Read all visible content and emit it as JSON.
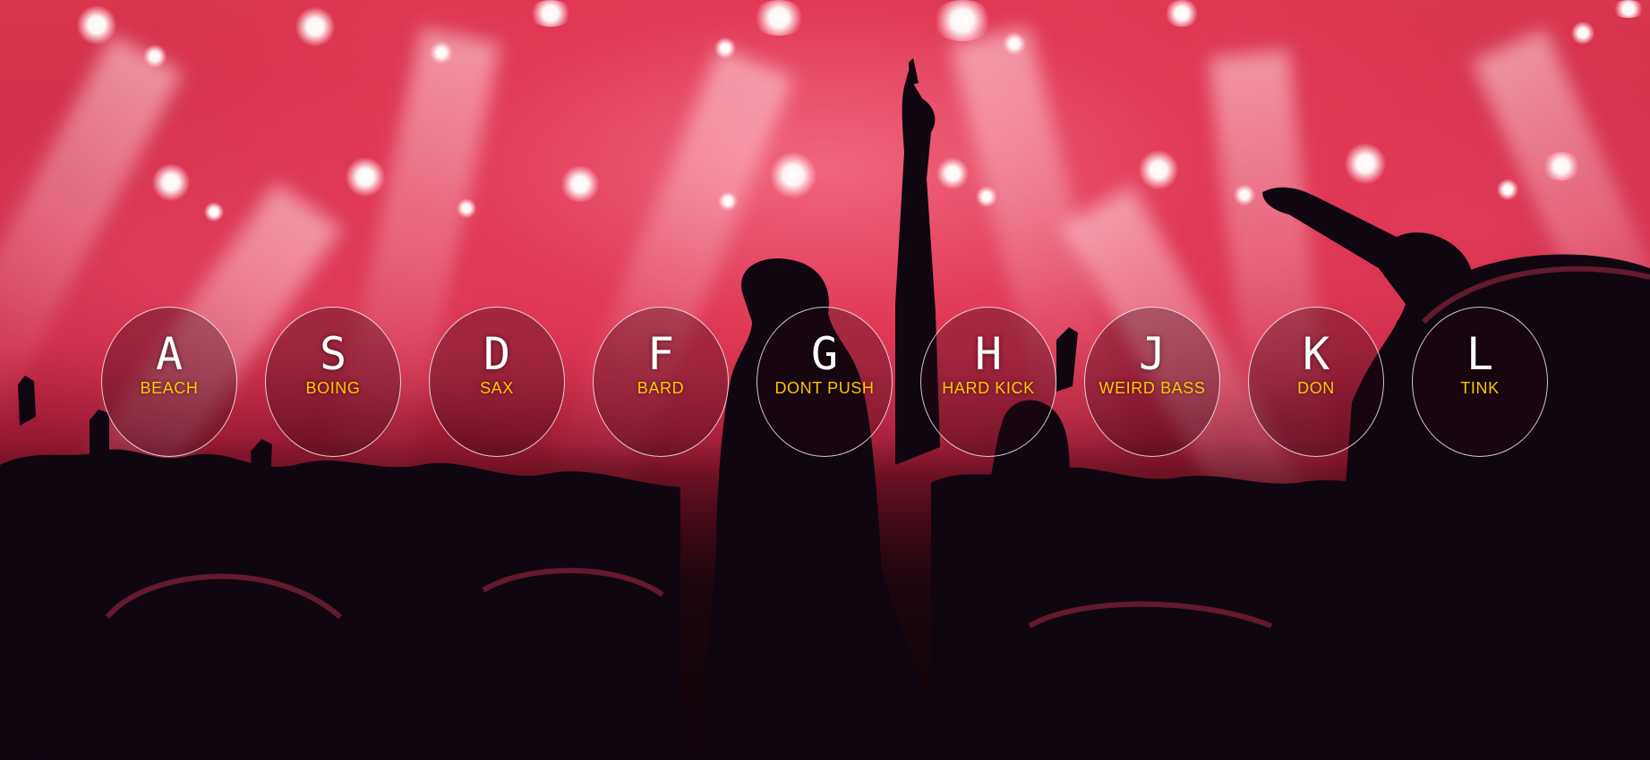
{
  "colors": {
    "letter": "#ffffff",
    "sound_label": "#ffc600",
    "key_border": "#ffffff",
    "background_stage": "#d8354f"
  },
  "background": {
    "icon": "concert-crowd-photo"
  },
  "keys": [
    {
      "letter": "A",
      "sound": "BEACH"
    },
    {
      "letter": "S",
      "sound": "BOING"
    },
    {
      "letter": "D",
      "sound": "SAX"
    },
    {
      "letter": "F",
      "sound": "BARD"
    },
    {
      "letter": "G",
      "sound": "DONT PUSH"
    },
    {
      "letter": "H",
      "sound": "HARD KICK"
    },
    {
      "letter": "J",
      "sound": "WEIRD BASS"
    },
    {
      "letter": "K",
      "sound": "DON"
    },
    {
      "letter": "L",
      "sound": "TINK"
    }
  ]
}
